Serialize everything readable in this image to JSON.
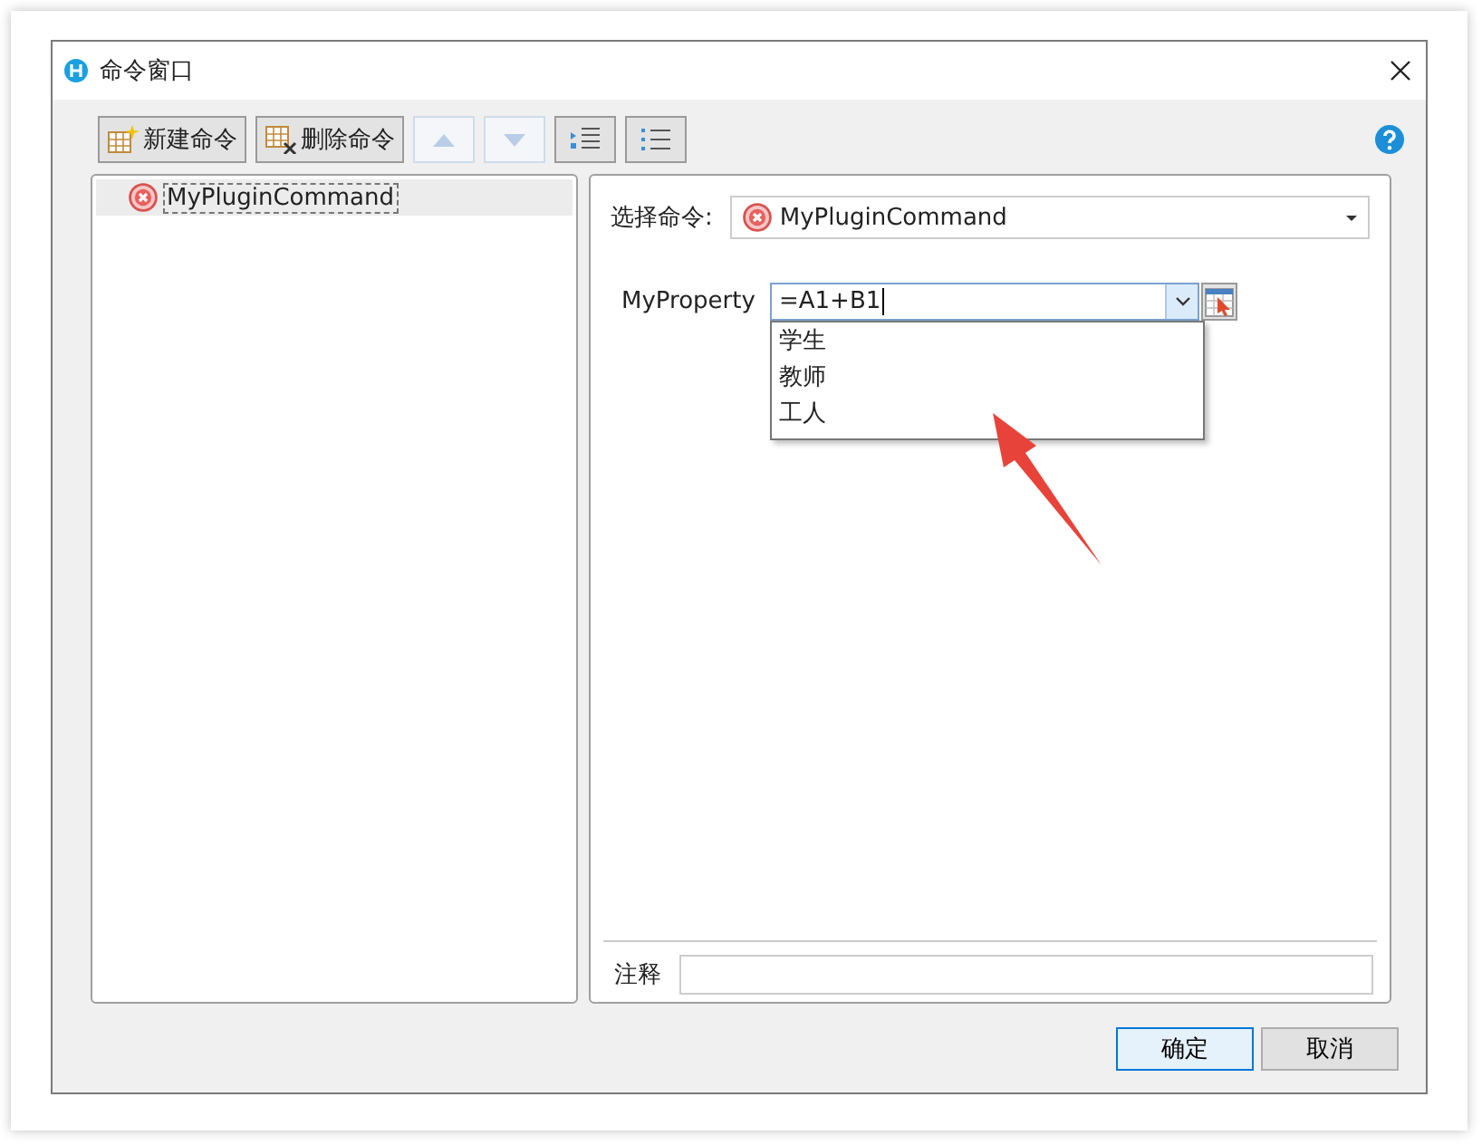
{
  "window": {
    "title": "命令窗口"
  },
  "toolbar": [
    {
      "kind": "new",
      "label": "新建命令",
      "disabled": false
    },
    {
      "kind": "delete",
      "label": "删除命令",
      "disabled": false
    },
    {
      "kind": "up",
      "disabled": true
    },
    {
      "kind": "down",
      "disabled": true
    },
    {
      "kind": "indent",
      "disabled": false
    },
    {
      "kind": "outdent",
      "disabled": false
    }
  ],
  "command_list": [
    {
      "label": "MyPluginCommand",
      "selected": true
    }
  ],
  "detail": {
    "select_label": "选择命令:",
    "selected_command": "MyPluginCommand",
    "properties": [
      {
        "name": "MyProperty",
        "value": "=A1+B1",
        "expanded": true,
        "options": [
          "学生",
          "教师",
          "工人"
        ]
      }
    ],
    "note_label": "注释"
  },
  "buttons": [
    {
      "label": "确定",
      "default": true
    },
    {
      "label": "取消",
      "default": false
    }
  ]
}
